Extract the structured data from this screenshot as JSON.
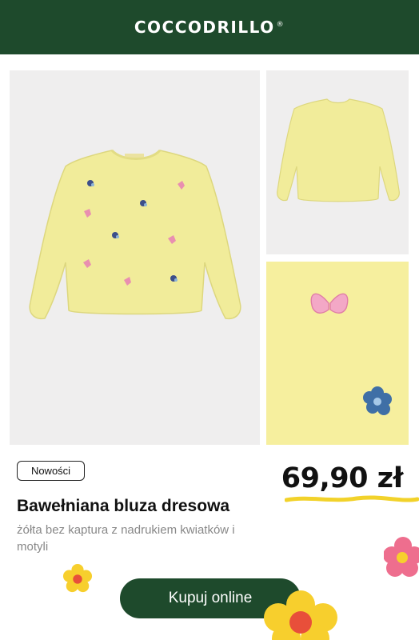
{
  "header": {
    "brand": "COCCODRILLO",
    "trademark": "®",
    "background": "#1e4a2c"
  },
  "product": {
    "badge": "Nowości",
    "price": "69,90 zł",
    "title": "Bawełniana bluza dresowa",
    "description": "żółta bez kaptura z nadrukiem kwiatków i motyli"
  },
  "cta": {
    "label": "Kupuj online",
    "background": "#1e4a2c"
  },
  "colors": {
    "sweater": "#f1ec9a",
    "underline": "#f2d22a",
    "flower_pink": "#ee6e8e",
    "flower_yellow": "#f7cf2d"
  }
}
